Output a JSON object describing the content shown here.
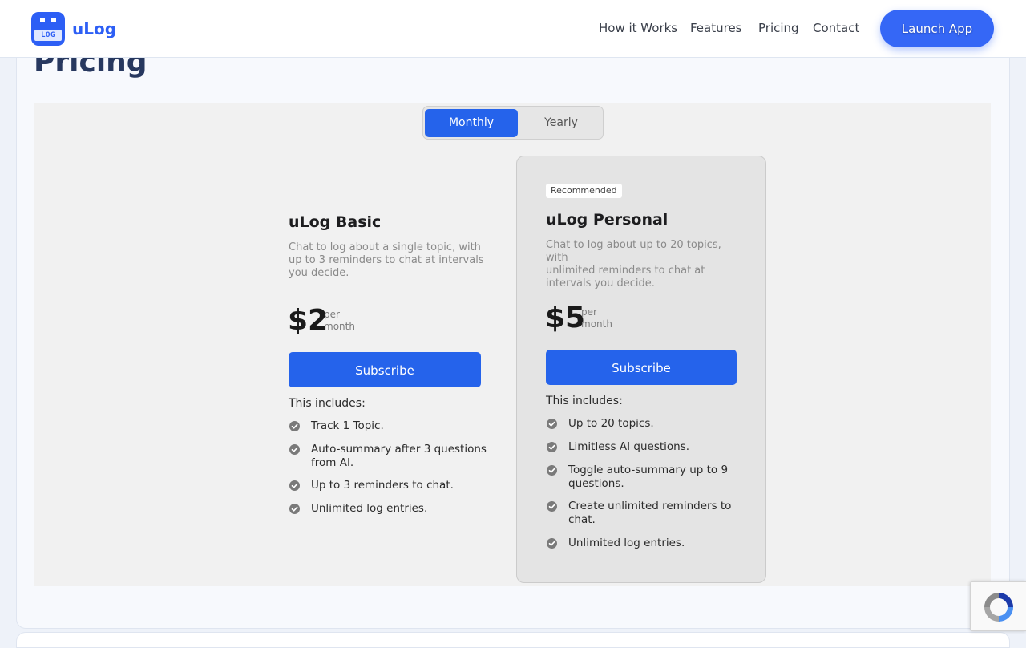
{
  "header": {
    "logo_text": "LOG",
    "brand": "uLog",
    "nav": [
      "How it Works",
      "Features",
      "Pricing",
      "Contact"
    ],
    "launch_label": "Launch App"
  },
  "pricing": {
    "title": "Pricing",
    "toggle": {
      "monthly": "Monthly",
      "yearly": "Yearly",
      "selected": "Monthly"
    },
    "plans": [
      {
        "name": "uLog Basic",
        "description": [
          "Chat to log about a single topic, with",
          "up to 3 reminders to chat at intervals",
          "you decide."
        ],
        "price": "$2",
        "per": [
          "per",
          "month"
        ],
        "cta": "Subscribe",
        "includes_label": "This includes:",
        "features": [
          [
            "Track 1 Topic."
          ],
          [
            "Auto-summary after 3 questions",
            "from AI."
          ],
          [
            "Up to 3 reminders to chat."
          ],
          [
            "Unlimited log entries."
          ]
        ]
      },
      {
        "badge": "Recommended",
        "name": "uLog Personal",
        "description": [
          "Chat to log about up to 20 topics, with",
          "unlimited reminders to chat at",
          "intervals you decide."
        ],
        "price": "$5",
        "per": [
          "per",
          "month"
        ],
        "cta": "Subscribe",
        "includes_label": "This includes:",
        "features": [
          [
            "Up to 20 topics."
          ],
          [
            "Limitless AI questions."
          ],
          [
            "Toggle auto-summary up to 9",
            "questions."
          ],
          [
            "Create unlimited reminders to",
            "chat."
          ],
          [
            "Unlimited log entries."
          ]
        ]
      }
    ]
  },
  "colors": {
    "accent": "#2563eb",
    "brand": "#2d5ff5",
    "title": "#27385f"
  },
  "icons": {
    "feature_bullet": "check-circle-icon",
    "recaptcha": "recaptcha-icon"
  }
}
